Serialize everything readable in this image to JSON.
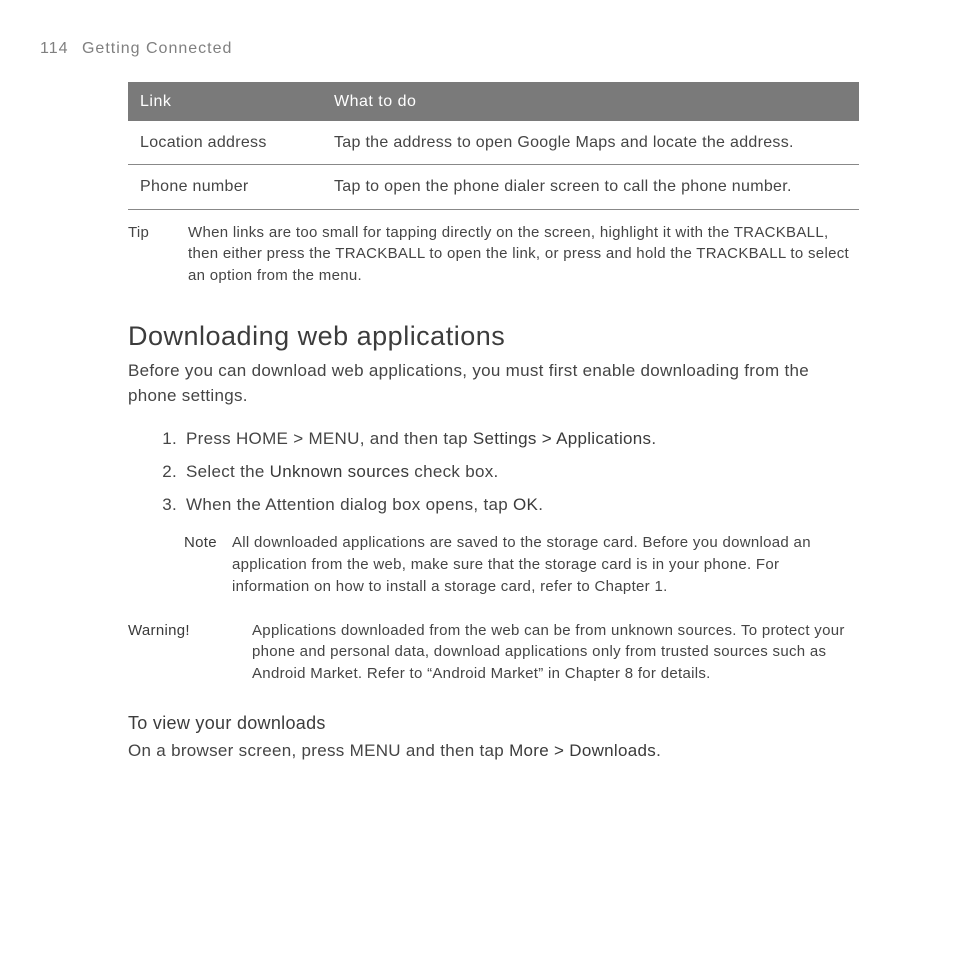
{
  "page_number": "114",
  "chapter": "Getting Connected",
  "table": {
    "header_link": "Link",
    "header_action": "What to do",
    "rows": [
      {
        "link": "Location address",
        "action": "Tap the address to open Google Maps and locate the address."
      },
      {
        "link": "Phone number",
        "action": "Tap to open the phone dialer screen to call the phone number."
      }
    ]
  },
  "tip": {
    "label": "Tip",
    "text": "When links are too small for tapping directly on the screen, highlight it with the TRACKBALL, then either press the TRACKBALL to open the link, or press and hold the TRACKBALL to select an option from the menu."
  },
  "section_title": "Downloading web applications",
  "intro": "Before you can download web applications, you must first enable downloading from the phone settings.",
  "steps": {
    "s1_a": "Press HOME > MENU, and then tap ",
    "s1_b": "Settings > Applications",
    "s1_c": ".",
    "s2_a": "Select the ",
    "s2_b": "Unknown sources",
    "s2_c": " check box.",
    "s3_a": "When the Attention dialog box opens, tap ",
    "s3_b": "OK",
    "s3_c": "."
  },
  "note": {
    "label": "Note",
    "text": "All downloaded applications are saved to the storage card. Before you download an application from the web, make sure that the storage card is in your phone. For information on how to install a storage card, refer to Chapter 1."
  },
  "warning": {
    "label": "Warning!",
    "text": "Applications downloaded from the web can be from unknown sources. To protect your phone and personal data, download applications only from trusted sources such as Android Market. Refer to “Android Market” in Chapter 8 for details."
  },
  "subheading": "To view your downloads",
  "downloads_a": "On a browser screen, press MENU and then tap ",
  "downloads_b": "More > Downloads",
  "downloads_c": "."
}
